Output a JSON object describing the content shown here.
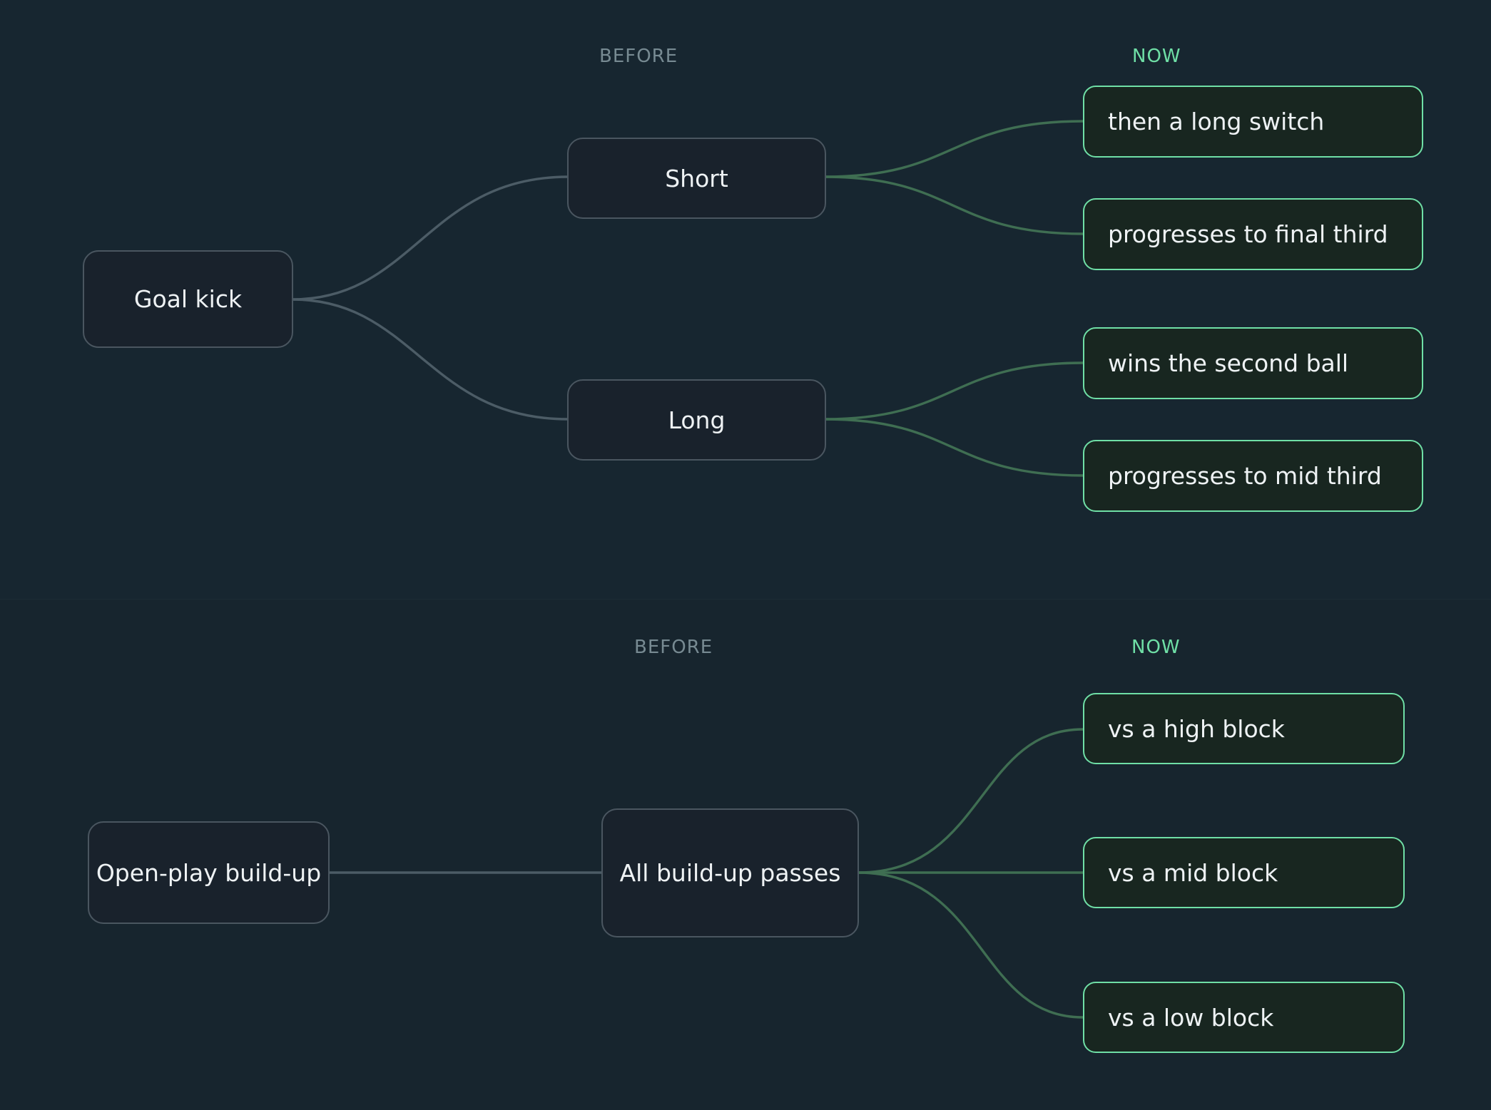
{
  "diagrams": [
    {
      "before_label": "BEFORE",
      "now_label": "NOW",
      "root": "Goal kick",
      "branches": [
        {
          "label": "Short",
          "outcomes": [
            "then a long switch",
            "progresses to final third"
          ]
        },
        {
          "label": "Long",
          "outcomes": [
            "wins the second ball",
            "progresses to mid third"
          ]
        }
      ]
    },
    {
      "before_label": "BEFORE",
      "now_label": "NOW",
      "root": "Open-play build-up",
      "branches": [
        {
          "label": "All build-up passes",
          "outcomes": [
            "vs a high block",
            "vs a mid block",
            "vs a low block"
          ]
        }
      ]
    }
  ],
  "colors": {
    "background": "#172630",
    "before_border": "#4a5660",
    "now_border": "#6fdfa6",
    "grey_link": "#4c5c66",
    "green_link": "#3f6e52",
    "before_label": "#778a92",
    "now_label": "#6fdfa6"
  }
}
